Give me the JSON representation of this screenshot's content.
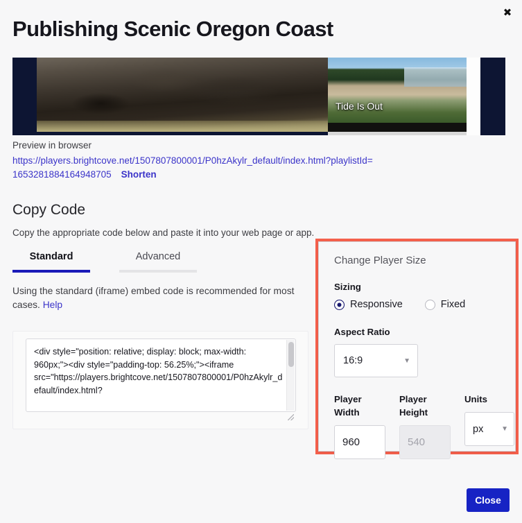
{
  "modal": {
    "title": "Publishing Scenic Oregon Coast",
    "close_icon": "close-x-icon",
    "footer_button": "Close"
  },
  "preview": {
    "label": "Preview in browser",
    "url": "https://players.brightcove.net/1507807800001/P0hzAkylr_default/index.html?playlistId=1653281884164948705",
    "shorten_label": "Shorten",
    "video_caption": "Tide Is Out"
  },
  "copy_code": {
    "heading": "Copy Code",
    "subheading": "Copy the appropriate code below and paste it into your web page or app.",
    "tabs": [
      {
        "label": "Standard",
        "active": true
      },
      {
        "label": "Advanced",
        "active": false
      }
    ],
    "description": "Using the standard (iframe) embed code is recommended for most cases.",
    "help_label": "Help",
    "code": "<div style=\"position: relative; display: block; max-width: 960px;\"><div style=\"padding-top: 56.25%;\"><iframe src=\"https://players.brightcove.net/1507807800001/P0hzAkylr_default/index.html?"
  },
  "player_size": {
    "title": "Change Player Size",
    "sizing_label": "Sizing",
    "sizing_options": [
      {
        "label": "Responsive",
        "checked": true
      },
      {
        "label": "Fixed",
        "checked": false
      }
    ],
    "aspect_ratio_label": "Aspect Ratio",
    "aspect_ratio_value": "16:9",
    "width_label": "Player Width",
    "width_value": "960",
    "height_label": "Player Height",
    "height_value": "540",
    "units_label": "Units",
    "units_value": "px",
    "highlight_color": "#f4604c"
  }
}
